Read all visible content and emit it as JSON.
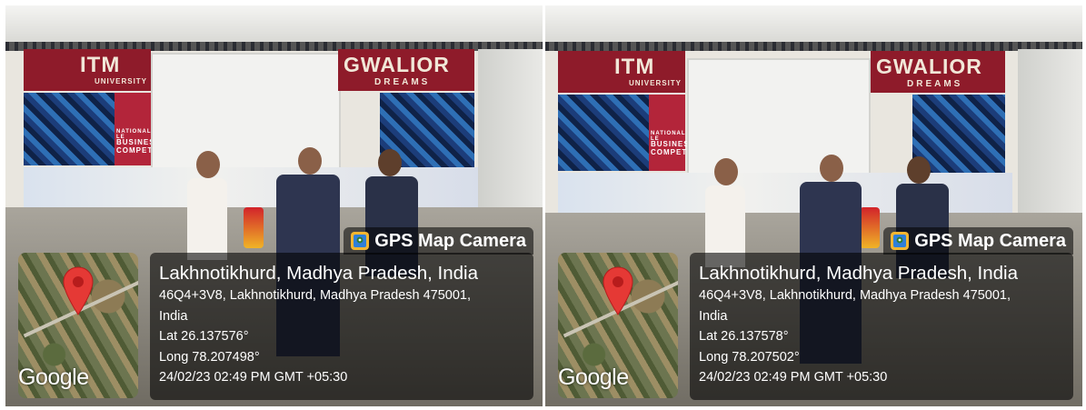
{
  "photos": [
    {
      "banners": {
        "university": "ITM",
        "sub": "UNIVERSITY",
        "city": "GWALIOR",
        "dreams": "DREAMS",
        "poster": "BUSINES COMPET",
        "national": "NATIONAL LE"
      },
      "app_name": "GPS Map Camera",
      "map_provider": "Google",
      "location_title": "Lakhnotikhurd, Madhya Pradesh, India",
      "address_line1": "46Q4+3V8, Lakhnotikhurd, Madhya Pradesh 475001,",
      "address_line2": "India",
      "lat": "Lat 26.137576°",
      "long": "Long 78.207498°",
      "datetime": "24/02/23 02:49 PM GMT +05:30"
    },
    {
      "banners": {
        "university": "ITM",
        "sub": "UNIVERSITY",
        "city": "GWALIOR",
        "dreams": "DREAMS",
        "poster": "BUSINES COMPET",
        "national": "NATIONAL LE"
      },
      "app_name": "GPS Map Camera",
      "map_provider": "Google",
      "location_title": "Lakhnotikhurd, Madhya Pradesh, India",
      "address_line1": "46Q4+3V8, Lakhnotikhurd, Madhya Pradesh 475001,",
      "address_line2": "India",
      "lat": "Lat 26.137578°",
      "long": "Long 78.207502°",
      "datetime": "24/02/23 02:49 PM GMT +05:30"
    }
  ],
  "colors": {
    "pin_red": "#e53935",
    "banner_red": "#8e1b2a",
    "overlay": "#000000"
  }
}
